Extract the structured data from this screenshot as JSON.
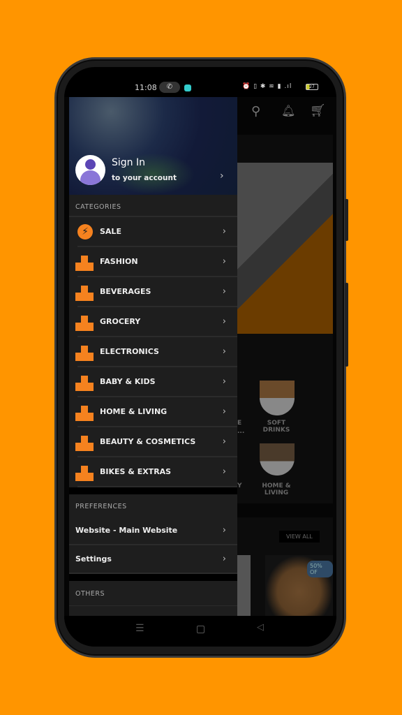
{
  "status_bar": {
    "time": "11:08",
    "battery": "27"
  },
  "toolbar": {
    "icons": [
      "search-icon",
      "bell-icon",
      "cart-icon"
    ]
  },
  "drawer": {
    "sign_in": {
      "title": "Sign In",
      "subtitle": "to your account"
    },
    "categories_heading": "CATEGORIES",
    "categories": [
      {
        "label": "SALE",
        "icon": "sale-icon"
      },
      {
        "label": "FASHION"
      },
      {
        "label": "BEVERAGES"
      },
      {
        "label": "GROCERY"
      },
      {
        "label": "ELECTRONICS"
      },
      {
        "label": "BABY & KIDS"
      },
      {
        "label": "HOME & LIVING"
      },
      {
        "label": "BEAUTY & COSMETICS"
      },
      {
        "label": "BIKES & EXTRAS"
      }
    ],
    "preferences_heading": "PREFERENCES",
    "preferences": [
      {
        "label": "Website - Main Website"
      },
      {
        "label": "Settings"
      }
    ],
    "others_heading": "OTHERS"
  },
  "background": {
    "category_tiles": [
      {
        "label": "SOFT DRINKS"
      },
      {
        "label": "HOME & LIVING"
      }
    ],
    "partial_labels": [
      "E",
      "...",
      "Y"
    ],
    "view_all": "VIEW ALL",
    "discount_badge": "50% OF"
  },
  "colors": {
    "accent": "#f5821f",
    "page_bg": "#ff9500",
    "drawer_bg": "#1e1e1e"
  }
}
